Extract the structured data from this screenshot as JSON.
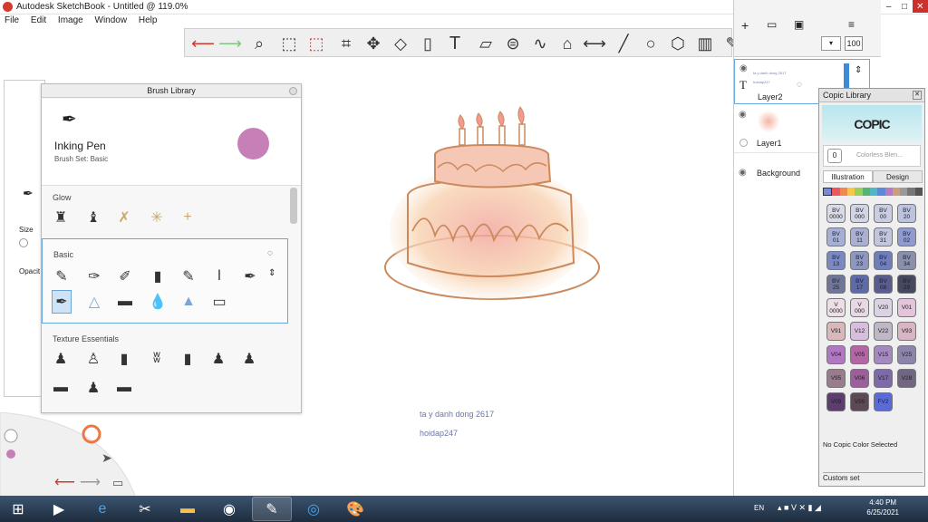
{
  "window": {
    "title": "Autodesk SketchBook - Untitled @ 119.0%",
    "min": "–",
    "max": "□",
    "close": "✕"
  },
  "menu": [
    "File",
    "Edit",
    "Image",
    "Window",
    "Help"
  ],
  "toolbar": {
    "tools": [
      "undo-icon",
      "redo-icon",
      "zoom-icon",
      "select-rect-icon",
      "select-magic-icon",
      "crop-icon",
      "transform-icon",
      "distort-icon",
      "fill-icon",
      "text-icon",
      "ruler-icon",
      "ellipse-guide-icon",
      "french-curve-icon",
      "perspective-icon",
      "symmetry-icon",
      "stroke-icon",
      "circle-icon",
      "shape-icon",
      "copic-icon",
      "brush-set-icon",
      "color-wheel-icon",
      "layer-grid-icon"
    ]
  },
  "top_right": {
    "opacity_value": "100"
  },
  "brush_library": {
    "title": "Brush Library",
    "brush_name": "Inking Pen",
    "brush_set": "Brush Set: Basic",
    "color": "#c77fb8",
    "sections": [
      "Glow",
      "Basic",
      "Texture Essentials"
    ]
  },
  "left_panel": {
    "size_label": "Size",
    "opacity_label": "Opacit"
  },
  "layers": [
    {
      "name": "Layer2",
      "thumb_text": "ta y danh dong 2617",
      "thumb_sub": "hoidap247"
    },
    {
      "name": "Layer1"
    },
    {
      "name": "Background"
    }
  ],
  "copic": {
    "title": "Copic Library",
    "logo": "COPIC",
    "colorless": "Colorless Blen...",
    "colorless_code": "0",
    "tabs": [
      "Illustration",
      "Design"
    ],
    "swatches": [
      {
        "code": "BV\n0000",
        "color": "#d9dbe6"
      },
      {
        "code": "BV\n000",
        "color": "#d2d5e4"
      },
      {
        "code": "BV\n00",
        "color": "#c9cde2"
      },
      {
        "code": "BV\n20",
        "color": "#bcc3df"
      },
      {
        "code": "BV\n01",
        "color": "#a6b0d6"
      },
      {
        "code": "BV\n11",
        "color": "#aab0d4"
      },
      {
        "code": "BV\n31",
        "color": "#c2c5de"
      },
      {
        "code": "BV\n02",
        "color": "#8e9ad0"
      },
      {
        "code": "BV\n13",
        "color": "#7a89c4"
      },
      {
        "code": "BV\n23",
        "color": "#8e96c2"
      },
      {
        "code": "BV\n04",
        "color": "#6f7ebd"
      },
      {
        "code": "BV\n34",
        "color": "#8a8fae"
      },
      {
        "code": "BV\n25",
        "color": "#6f7697"
      },
      {
        "code": "BV\n17",
        "color": "#5f6aa8"
      },
      {
        "code": "BV\n08",
        "color": "#5a5c8e"
      },
      {
        "code": "BV\n29",
        "color": "#45485f"
      },
      {
        "code": "V\n0000",
        "color": "#ecdfe6"
      },
      {
        "code": "V\n000",
        "color": "#e6d8e4"
      },
      {
        "code": "V20",
        "color": "#d9d3e3"
      },
      {
        "code": "V01",
        "color": "#e3c4da"
      },
      {
        "code": "V91",
        "color": "#d9b8bc"
      },
      {
        "code": "V12",
        "color": "#d8bede"
      },
      {
        "code": "V22",
        "color": "#bfb7c6"
      },
      {
        "code": "V93",
        "color": "#d8b5c5"
      },
      {
        "code": "V04",
        "color": "#b277c4"
      },
      {
        "code": "V05",
        "color": "#b465a6"
      },
      {
        "code": "V15",
        "color": "#a689c1"
      },
      {
        "code": "V25",
        "color": "#8d84ab"
      },
      {
        "code": "V95",
        "color": "#9a7d8d"
      },
      {
        "code": "V06",
        "color": "#9d5f9b"
      },
      {
        "code": "V17",
        "color": "#7f6aa9"
      },
      {
        "code": "V28",
        "color": "#726783"
      },
      {
        "code": "V09",
        "color": "#5d3d6e"
      },
      {
        "code": "V99",
        "color": "#5b4a56"
      },
      {
        "code": "FV2",
        "color": "#5a6bd8"
      }
    ],
    "status": "No Copic Color Selected",
    "custom_set": "Custom set"
  },
  "canvas": {
    "text1": "ta y danh dong 2617",
    "text2": "hoidap247"
  },
  "taskbar": {
    "lang": "EN",
    "time": "4:40 PM",
    "date": "6/25/2021"
  }
}
